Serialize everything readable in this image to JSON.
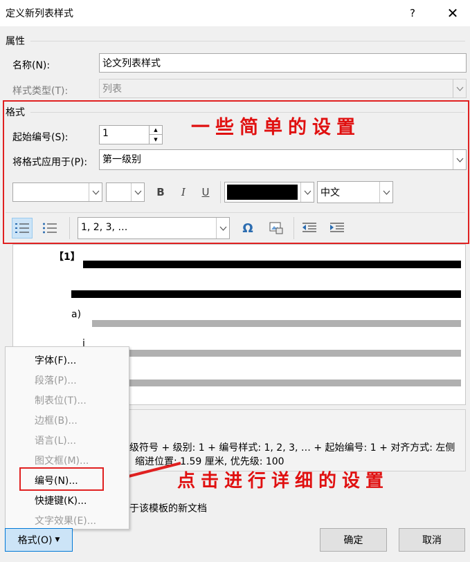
{
  "window": {
    "title": "定义新列表样式",
    "help": "?",
    "close": "✕"
  },
  "properties": {
    "section_label": "属性",
    "name_label": "名称(N):",
    "name_value": "论文列表样式",
    "style_type_label": "样式类型(T):",
    "style_type_value": "列表"
  },
  "format": {
    "section_label": "格式",
    "start_number_label": "起始编号(S):",
    "start_number_value": "1",
    "apply_to_label": "将格式应用于(P):",
    "apply_to_value": "第一级别",
    "font_name_value": "",
    "font_size_value": "",
    "bold": "B",
    "italic": "I",
    "underline": "U",
    "font_color": "#000000",
    "language_value": "中文",
    "numbering_style_value": "1, 2, 3, …",
    "symbol_glyph": "Ω"
  },
  "annotations": {
    "top": "一些简单的设置",
    "bottom": "点击进行详细的设置",
    "color": "#e02020"
  },
  "preview": {
    "level1_label": "【1】",
    "level2_label": "a)",
    "level3_label": "i"
  },
  "description": {
    "line1": "级符号 + 级别: 1 + 编号样式: 1, 2, 3, … + 起始编号: 1 + 对齐方式: 左侧",
    "line2": "缩进位置: 1.59 厘米, 优先级: 100"
  },
  "template_option_text": "于该模板的新文档",
  "menu": {
    "items": [
      {
        "label": "字体(F)...",
        "enabled": true
      },
      {
        "label": "段落(P)...",
        "enabled": false
      },
      {
        "label": "制表位(T)...",
        "enabled": false
      },
      {
        "label": "边框(B)...",
        "enabled": false
      },
      {
        "label": "语言(L)...",
        "enabled": false
      },
      {
        "label": "图文框(M)...",
        "enabled": false
      },
      {
        "label": "编号(N)...",
        "enabled": true
      },
      {
        "label": "快捷键(K)...",
        "enabled": true
      },
      {
        "label": "文字效果(E)...",
        "enabled": false
      }
    ]
  },
  "buttons": {
    "format": "格式(O)",
    "ok": "确定",
    "cancel": "取消"
  }
}
